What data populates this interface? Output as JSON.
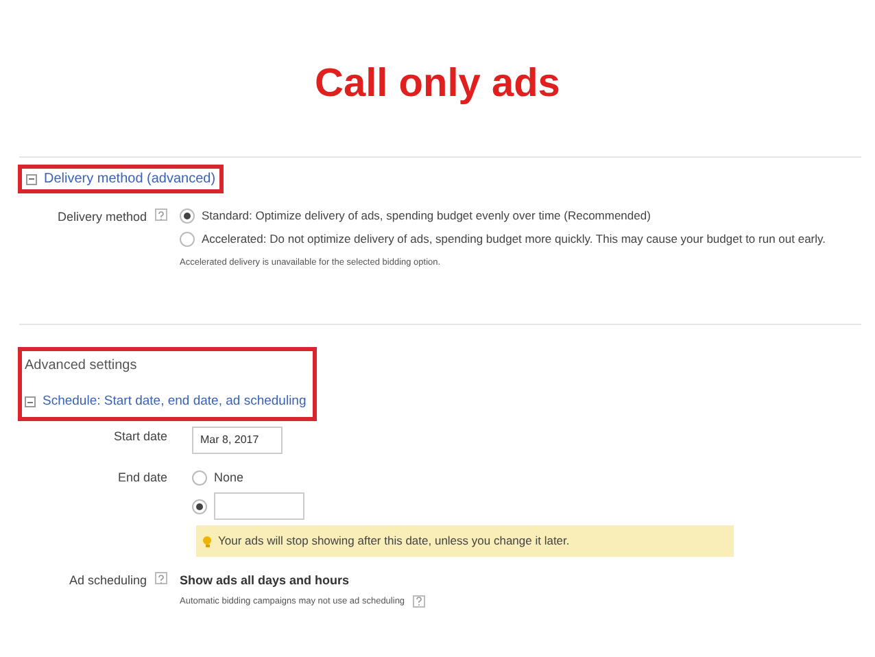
{
  "title": "Call only ads",
  "delivery_section": {
    "header": "Delivery method (advanced)",
    "highlighted": true
  },
  "delivery_method": {
    "label": "Delivery method",
    "options": [
      {
        "label": "Standard: Optimize delivery of ads, spending budget evenly over time (Recommended)",
        "selected": true
      },
      {
        "label": "Accelerated: Do not optimize delivery of ads, spending budget more quickly. This may cause your budget to run out early.",
        "selected": false
      }
    ],
    "note": "Accelerated delivery is unavailable for the selected bidding option."
  },
  "advanced": {
    "heading": "Advanced settings",
    "schedule_header": "Schedule: Start date, end date, ad scheduling",
    "highlighted": true
  },
  "start_date": {
    "label": "Start date",
    "value": "Mar 8, 2017"
  },
  "end_date": {
    "label": "End date",
    "options": [
      {
        "kind": "text",
        "label": "None",
        "selected": false
      },
      {
        "kind": "field",
        "selected": true
      }
    ]
  },
  "warning": "Your ads will stop showing after this date, unless you change it later.",
  "ad_scheduling": {
    "label": "Ad scheduling",
    "value": "Show ads all days and hours",
    "note": "Automatic bidding campaigns may not use ad scheduling"
  }
}
